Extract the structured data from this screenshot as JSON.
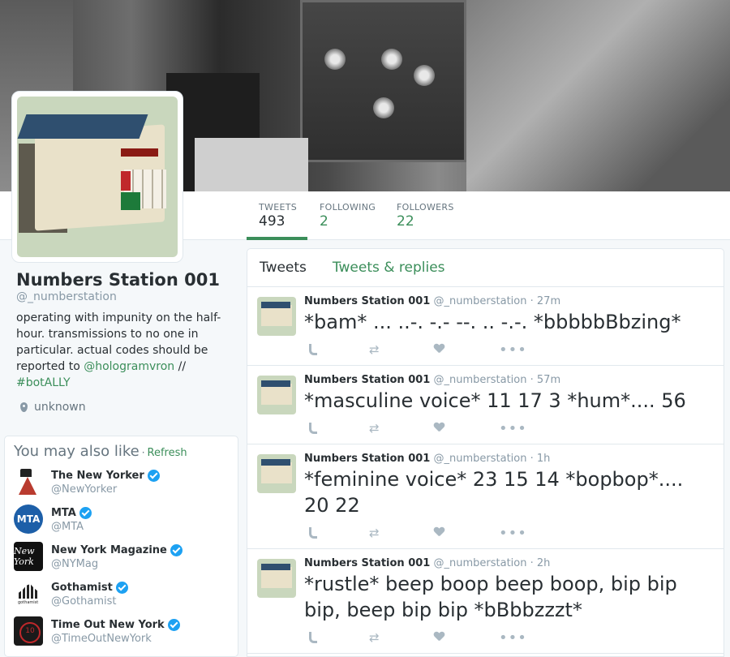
{
  "profile": {
    "name": "Numbers Station 001",
    "handle": "@_numberstation",
    "bio_text": "operating with impunity on the half-hour. transmissions to no one in particular. actual codes should be reported to",
    "bio_mention": "@hologramvron",
    "bio_sep": " //",
    "bio_hashtag": "#botALLY",
    "location": "unknown"
  },
  "stats": {
    "tweets_label": "TWEETS",
    "tweets_value": "493",
    "following_label": "FOLLOWING",
    "following_value": "2",
    "followers_label": "FOLLOWERS",
    "followers_value": "22"
  },
  "wtf": {
    "title": "You may also like",
    "dot": "·",
    "refresh": "Refresh",
    "suggestions": [
      {
        "name": "The New Yorker",
        "handle": "@NewYorker"
      },
      {
        "name": "MTA",
        "handle": "@MTA",
        "avatar_text": "MTA"
      },
      {
        "name": "New York Magazine",
        "handle": "@NYMag",
        "avatar_text": "New York"
      },
      {
        "name": "Gothamist",
        "handle": "@Gothamist"
      },
      {
        "name": "Time Out New York",
        "handle": "@TimeOutNewYork"
      }
    ]
  },
  "timeline": {
    "tabs": [
      "Tweets",
      "Tweets & replies"
    ],
    "tweets": [
      {
        "name": "Numbers Station 001",
        "handle": "@_numberstation",
        "sep": "·",
        "time": "27m",
        "text": "*bam* ... ..-. -.- --. .. -.-. *bbbbbBbzing*"
      },
      {
        "name": "Numbers Station 001",
        "handle": "@_numberstation",
        "sep": "·",
        "time": "57m",
        "text": "*masculine voice* 11 17 3 *hum*.... 56"
      },
      {
        "name": "Numbers Station 001",
        "handle": "@_numberstation",
        "sep": "·",
        "time": "1h",
        "text": "*feminine voice* 23 15 14 *bopbop*.... 20 22"
      },
      {
        "name": "Numbers Station 001",
        "handle": "@_numberstation",
        "sep": "·",
        "time": "2h",
        "text": "*rustle* beep boop beep boop, bip bip bip, beep bip bip *bBbbzzzt*"
      }
    ]
  },
  "icons": {
    "reply": "reply-icon",
    "retweet": "retweet-icon",
    "like": "heart-icon",
    "more": "more-icon",
    "location": "location-pin-icon",
    "verified": "verified-badge-icon"
  },
  "colors": {
    "accent": "#3b8e5a",
    "verified": "#1da1f2",
    "muted": "#8899a6"
  }
}
